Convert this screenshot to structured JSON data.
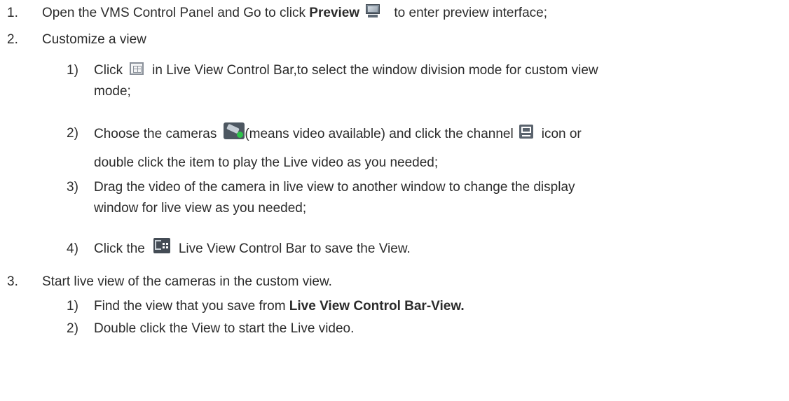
{
  "step1": {
    "number": "1.",
    "text_a": "Open the VMS Control Panel and Go to click ",
    "bold": "Preview",
    "text_b": " to enter preview interface;",
    "icon": "monitor-icon"
  },
  "step2": {
    "number": "2.",
    "title": "Customize a view",
    "sub1": {
      "number": "1)",
      "text_a": "Click",
      "icon": "window-division-icon",
      "text_b": "in Live View Control Bar,to select the window division mode for custom view",
      "text_c": "mode;"
    },
    "sub2": {
      "number": "2)",
      "text_a": "Choose the cameras",
      "icon_camera": "camera-online-icon",
      "text_b": "(means video available) and click the channel",
      "icon_channel": "channel-play-icon",
      "text_c": "icon or",
      "text_d": "double click the item to play the Live video as you needed;"
    },
    "sub3": {
      "number": "3)",
      "text_a": "Drag the video of the camera in live view to another window to change the display",
      "text_b": "window for live view as you needed;"
    },
    "sub4": {
      "number": "4)",
      "text_a": "Click the",
      "icon": "save-view-icon",
      "text_b": "Live View Control Bar to save the View."
    }
  },
  "step3": {
    "number": "3.",
    "title": "Start live view of the cameras in the custom view.",
    "sub1": {
      "number": "1)",
      "text_a": "Find the view that you save from ",
      "bold": "Live View Control Bar-View."
    },
    "sub2": {
      "number": "2)",
      "text_a": "Double click the View to start the Live video."
    }
  }
}
